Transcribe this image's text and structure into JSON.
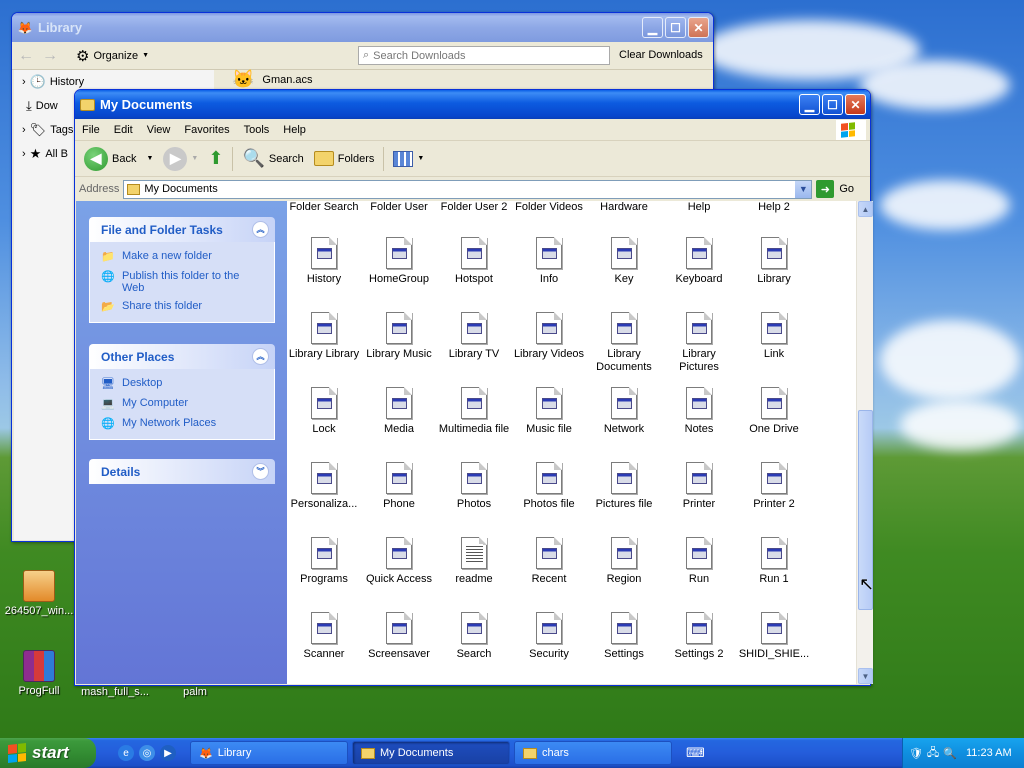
{
  "library": {
    "title": "Library",
    "organize_label": "Organize",
    "search_placeholder": "Search Downloads",
    "clear_label": "Clear Downloads",
    "tree": [
      "History",
      "Dow",
      "Tags",
      "All B"
    ],
    "download_file": "Gman.acs"
  },
  "mydocs": {
    "title": "My Documents",
    "menu": [
      "File",
      "Edit",
      "View",
      "Favorites",
      "Tools",
      "Help"
    ],
    "toolbar": {
      "back": "Back",
      "search": "Search",
      "folders": "Folders"
    },
    "address_label": "Address",
    "address_value": "My Documents",
    "go_label": "Go",
    "tasks": {
      "file_title": "File and Folder Tasks",
      "file_links": [
        "Make a new folder",
        "Publish this folder to the Web",
        "Share this folder"
      ],
      "other_title": "Other Places",
      "other_links": [
        "Desktop",
        "My Computer",
        "My Network Places"
      ],
      "details_title": "Details"
    },
    "partial_row": [
      "Folder Search",
      "Folder User",
      "Folder User 2",
      "Folder Videos",
      "Hardware",
      "Help",
      "Help 2"
    ],
    "rows": [
      [
        "History",
        "HomeGroup",
        "Hotspot",
        "Info",
        "Key",
        "Keyboard",
        "Library"
      ],
      [
        "Library Library",
        "Library Music",
        "Library TV",
        "Library Videos",
        "Library Documents",
        "Library Pictures",
        "Link"
      ],
      [
        "Lock",
        "Media",
        "Multimedia file",
        "Music file",
        "Network",
        "Notes",
        "One Drive"
      ],
      [
        "Personaliza...",
        "Phone",
        "Photos",
        "Photos file",
        "Pictures file",
        "Printer",
        "Printer 2"
      ],
      [
        "Programs",
        "Quick Access",
        "readme",
        "Recent",
        "Region",
        "Run",
        "Run 1"
      ],
      [
        "Scanner",
        "Screensaver",
        "Search",
        "Security",
        "Settings",
        "Settings 2",
        "SHIDI_SHIE..."
      ]
    ]
  },
  "desktop_icons": [
    "264507_win...",
    "ProgFull",
    "mash_full_s...",
    "palm"
  ],
  "taskbar": {
    "start_label": "start",
    "tasks": [
      "Library",
      "My Documents",
      "chars"
    ],
    "clock": "11:23 AM"
  }
}
